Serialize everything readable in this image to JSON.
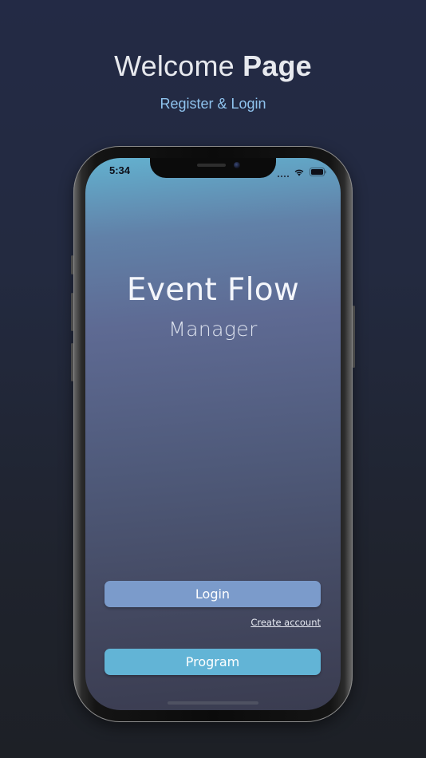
{
  "promo": {
    "title_regular": "Welcome",
    "title_bold": "Page",
    "subtitle": "Register & Login"
  },
  "status_bar": {
    "time": "5:34",
    "icons": [
      "signal-dots-icon",
      "wifi-icon",
      "battery-icon"
    ]
  },
  "app": {
    "title": "Event Flow",
    "subtitle": "Manager"
  },
  "actions": {
    "login_label": "Login",
    "create_account_label": "Create account",
    "program_label": "Program"
  },
  "colors": {
    "login_button": "#7b9bcb",
    "program_button": "#62b4d6",
    "promo_subtitle": "#8fc3ee"
  }
}
